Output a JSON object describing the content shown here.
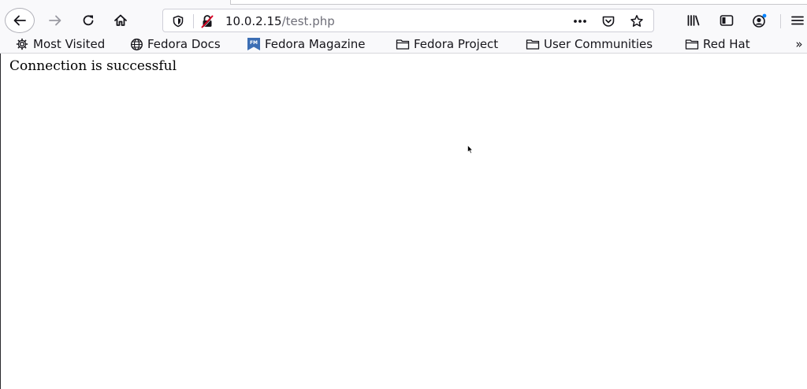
{
  "navigation": {
    "back_icon": "arrow-left-icon",
    "forward_icon": "arrow-right-icon",
    "reload_icon": "reload-icon",
    "home_icon": "home-icon"
  },
  "url_bar": {
    "host": "10.0.2.15",
    "path": "/test.php",
    "tracking_protection_icon": "shield-icon",
    "insecure_icon": "insecure-lock-icon",
    "page_actions_icon": "more-dots-icon",
    "pocket_icon": "pocket-icon",
    "bookmark_star_icon": "star-icon"
  },
  "toolbar": {
    "library_icon": "library-icon",
    "sidebar_icon": "sidebar-icon",
    "account_icon": "account-icon",
    "menu_icon": "hamburger-menu-icon"
  },
  "bookmarks": [
    {
      "label": "Most Visited",
      "icon": "gear-icon"
    },
    {
      "label": "Fedora Docs",
      "icon": "globe-icon"
    },
    {
      "label": "Fedora Magazine",
      "icon": "fedora-magazine-icon"
    },
    {
      "label": "Fedora Project",
      "icon": "folder-icon"
    },
    {
      "label": "User Communities",
      "icon": "folder-icon"
    },
    {
      "label": "Red Hat",
      "icon": "folder-icon"
    }
  ],
  "bookmarks_overflow": "»",
  "page": {
    "message": "Connection is successful"
  },
  "colors": {
    "toolbar_bg": "#f9f9fb",
    "page_bg": "#ffffff",
    "insecure_red": "#d70022",
    "fedora_magazine_blue": "#3c6eb4"
  }
}
